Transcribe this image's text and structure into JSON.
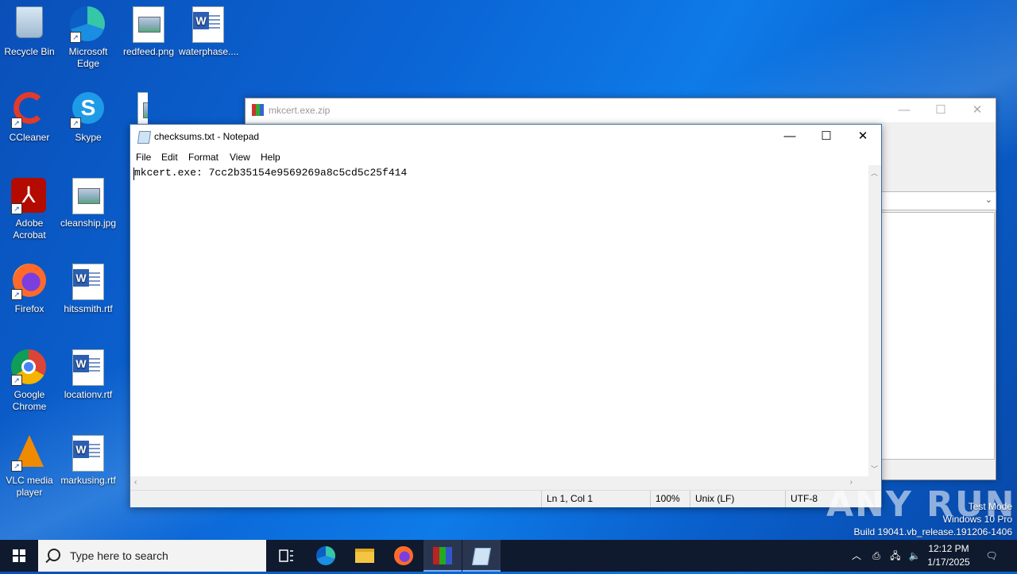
{
  "desktop": {
    "icons": [
      {
        "label": "Recycle Bin"
      },
      {
        "label": "Microsoft Edge"
      },
      {
        "label": "redfeed.png"
      },
      {
        "label": "waterphase...."
      },
      {
        "label": "CCleaner"
      },
      {
        "label": "Skype"
      },
      {
        "label": "Adobe Acrobat"
      },
      {
        "label": "cleanship.jpg"
      },
      {
        "label": "Firefox"
      },
      {
        "label": "hitssmith.rtf"
      },
      {
        "label": "Google Chrome"
      },
      {
        "label": "locationv.rtf"
      },
      {
        "label": "VLC media player"
      },
      {
        "label": "markusing.rtf"
      }
    ]
  },
  "winrar": {
    "title": "mkcert.exe.zip"
  },
  "notepad": {
    "title": "checksums.txt - Notepad",
    "menu": [
      "File",
      "Edit",
      "Format",
      "View",
      "Help"
    ],
    "content": "mkcert.exe: 7cc2b35154e9569269a8c5cd5c25f414",
    "status": {
      "position": "Ln 1, Col 1",
      "zoom": "100%",
      "line_endings": "Unix (LF)",
      "encoding": "UTF-8"
    }
  },
  "watermark": {
    "text": "ANY RUN"
  },
  "test_mode": {
    "line1": "Test Mode",
    "line2": "Windows 10 Pro",
    "line3": "Build 19041.vb_release.191206-1406"
  },
  "taskbar": {
    "search_placeholder": "Type here to search",
    "time": "12:12 PM",
    "date": "1/17/2025"
  }
}
